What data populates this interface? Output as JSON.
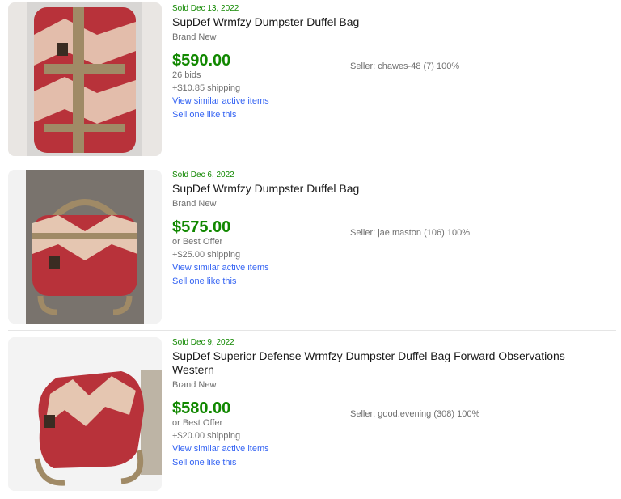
{
  "listings": [
    {
      "sold": "Sold Dec 13, 2022",
      "title": "SupDef Wrmfzy Dumpster Duffel Bag",
      "condition": "Brand New",
      "price": "$590.00",
      "sub": "26 bids",
      "shipping": "+$10.85 shipping",
      "link_similar": "View similar active items",
      "link_sell": "Sell one like this",
      "seller": "Seller: chawes-48 (7) 100%"
    },
    {
      "sold": "Sold Dec 6, 2022",
      "title": "SupDef Wrmfzy Dumpster Duffel Bag",
      "condition": "Brand New",
      "price": "$575.00",
      "sub": "or Best Offer",
      "shipping": "+$25.00 shipping",
      "link_similar": "View similar active items",
      "link_sell": "Sell one like this",
      "seller": "Seller: jae.maston (106) 100%"
    },
    {
      "sold": "Sold Dec 9, 2022",
      "title": "SupDef Superior Defense Wrmfzy Dumpster Duffel Bag Forward Observations Western",
      "condition": "Brand New",
      "price": "$580.00",
      "sub": "or Best Offer",
      "shipping": "+$20.00 shipping",
      "link_similar": "View similar active items",
      "link_sell": "Sell one like this",
      "seller": "Seller: good.evening (308) 100%"
    }
  ],
  "colors": {
    "sold_green": "#118800",
    "price_green": "#118800",
    "link_blue": "#3665f3",
    "muted_gray": "#707070",
    "bag_red": "#b8323a",
    "bag_tan": "#a08a66"
  }
}
